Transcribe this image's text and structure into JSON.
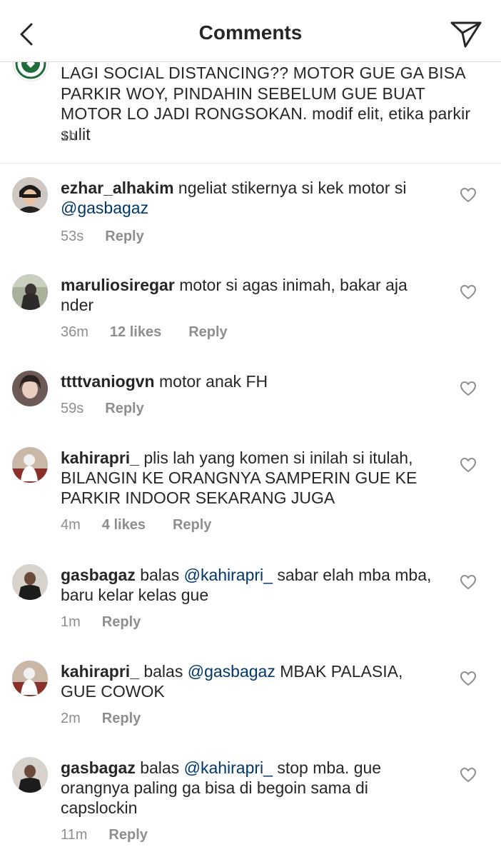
{
  "header": {
    "title": "Comments"
  },
  "caption": {
    "text": "LAGI SOCIAL DISTANCING?? MOTOR GUE GA BISA PARKIR WOY, PINDAHIN SEBELUM GUE BUAT MOTOR LO JADI RONGSOKAN. modif elit, etika parkir sulit",
    "time": "1h"
  },
  "comments": [
    {
      "user": "ezhar_alhakim",
      "prefix": "",
      "mention": "",
      "text": "ngeliat stikernya si kek motor si",
      "mention_after": "@gasbagaz",
      "time": "53s",
      "likes": "",
      "reply": "Reply"
    },
    {
      "user": "maruliosiregar",
      "prefix": "",
      "mention": "",
      "text": "motor si agas inimah, bakar aja nder",
      "mention_after": "",
      "time": "36m",
      "likes": "12 likes",
      "reply": "Reply"
    },
    {
      "user": "ttttvaniogvn",
      "prefix": "",
      "mention": "",
      "text": "motor anak FH",
      "mention_after": "",
      "time": "59s",
      "likes": "",
      "reply": "Reply"
    },
    {
      "user": "kahirapri_",
      "prefix": "",
      "mention": "",
      "text": "plis lah yang komen si inilah si itulah, BILANGIN KE ORANGNYA SAMPERIN GUE KE PARKIR INDOOR SEKARANG JUGA",
      "mention_after": "",
      "time": "4m",
      "likes": "4 likes",
      "reply": "Reply"
    },
    {
      "user": "gasbagaz",
      "prefix": "balas",
      "mention": "@kahirapri_",
      "text": "sabar elah mba mba, baru kelar kelas gue",
      "mention_after": "",
      "time": "1m",
      "likes": "",
      "reply": "Reply"
    },
    {
      "user": "kahirapri_",
      "prefix": "balas",
      "mention": "@gasbagaz",
      "text": "MBAK PALASIA, GUE COWOK",
      "mention_after": "",
      "time": "2m",
      "likes": "",
      "reply": "Reply"
    },
    {
      "user": "gasbagaz",
      "prefix": "balas",
      "mention": "@kahirapri_",
      "text": "stop mba. gue orangnya paling ga bisa di begoin sama di capslockin",
      "mention_after": "",
      "time": "11m",
      "likes": "",
      "reply": "Reply"
    }
  ]
}
